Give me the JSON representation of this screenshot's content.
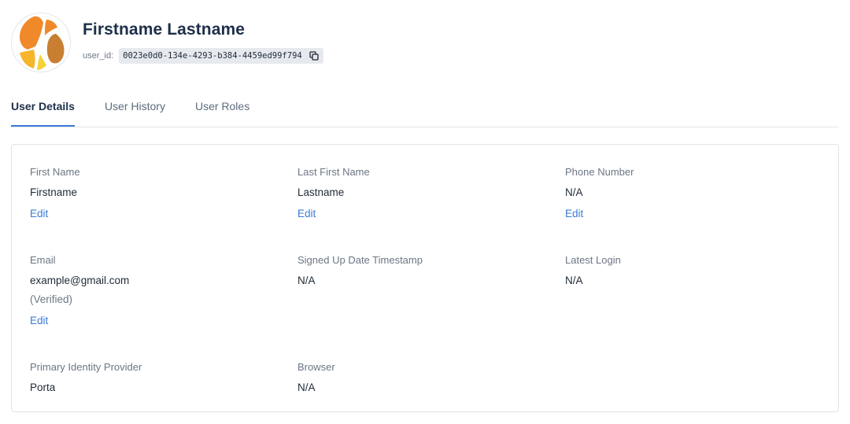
{
  "header": {
    "user_name": "Firstname Lastname",
    "user_id_label": "user_id:",
    "user_id": "0023e0d0-134e-4293-b384-4459ed99f794",
    "copy_icon": "copy-icon",
    "avatar_icon": "avatar-logo-icon"
  },
  "tabs": [
    {
      "label": "User Details",
      "active": true
    },
    {
      "label": "User History",
      "active": false
    },
    {
      "label": "User Roles",
      "active": false
    }
  ],
  "details": {
    "first_name": {
      "label": "First Name",
      "value": "Firstname",
      "edit": "Edit"
    },
    "last_name": {
      "label": "Last First Name",
      "value": "Lastname",
      "edit": "Edit"
    },
    "phone": {
      "label": "Phone Number",
      "value": "N/A",
      "edit": "Edit"
    },
    "email": {
      "label": "Email",
      "value": "example@gmail.com",
      "status": "(Verified)",
      "edit": "Edit"
    },
    "signed_up": {
      "label": "Signed Up Date Timestamp",
      "value": "N/A"
    },
    "latest_login": {
      "label": "Latest Login",
      "value": "N/A"
    },
    "identity_provider": {
      "label": "Primary Identity Provider",
      "value": "Porta"
    },
    "browser": {
      "label": "Browser",
      "value": "N/A"
    }
  },
  "colors": {
    "accent": "#3a7bd5",
    "title": "#1e2f4a",
    "muted": "#6b7685",
    "avatar_orange": "#f0892a",
    "avatar_yellow": "#f7b52b",
    "avatar_brown": "#c87f32"
  }
}
